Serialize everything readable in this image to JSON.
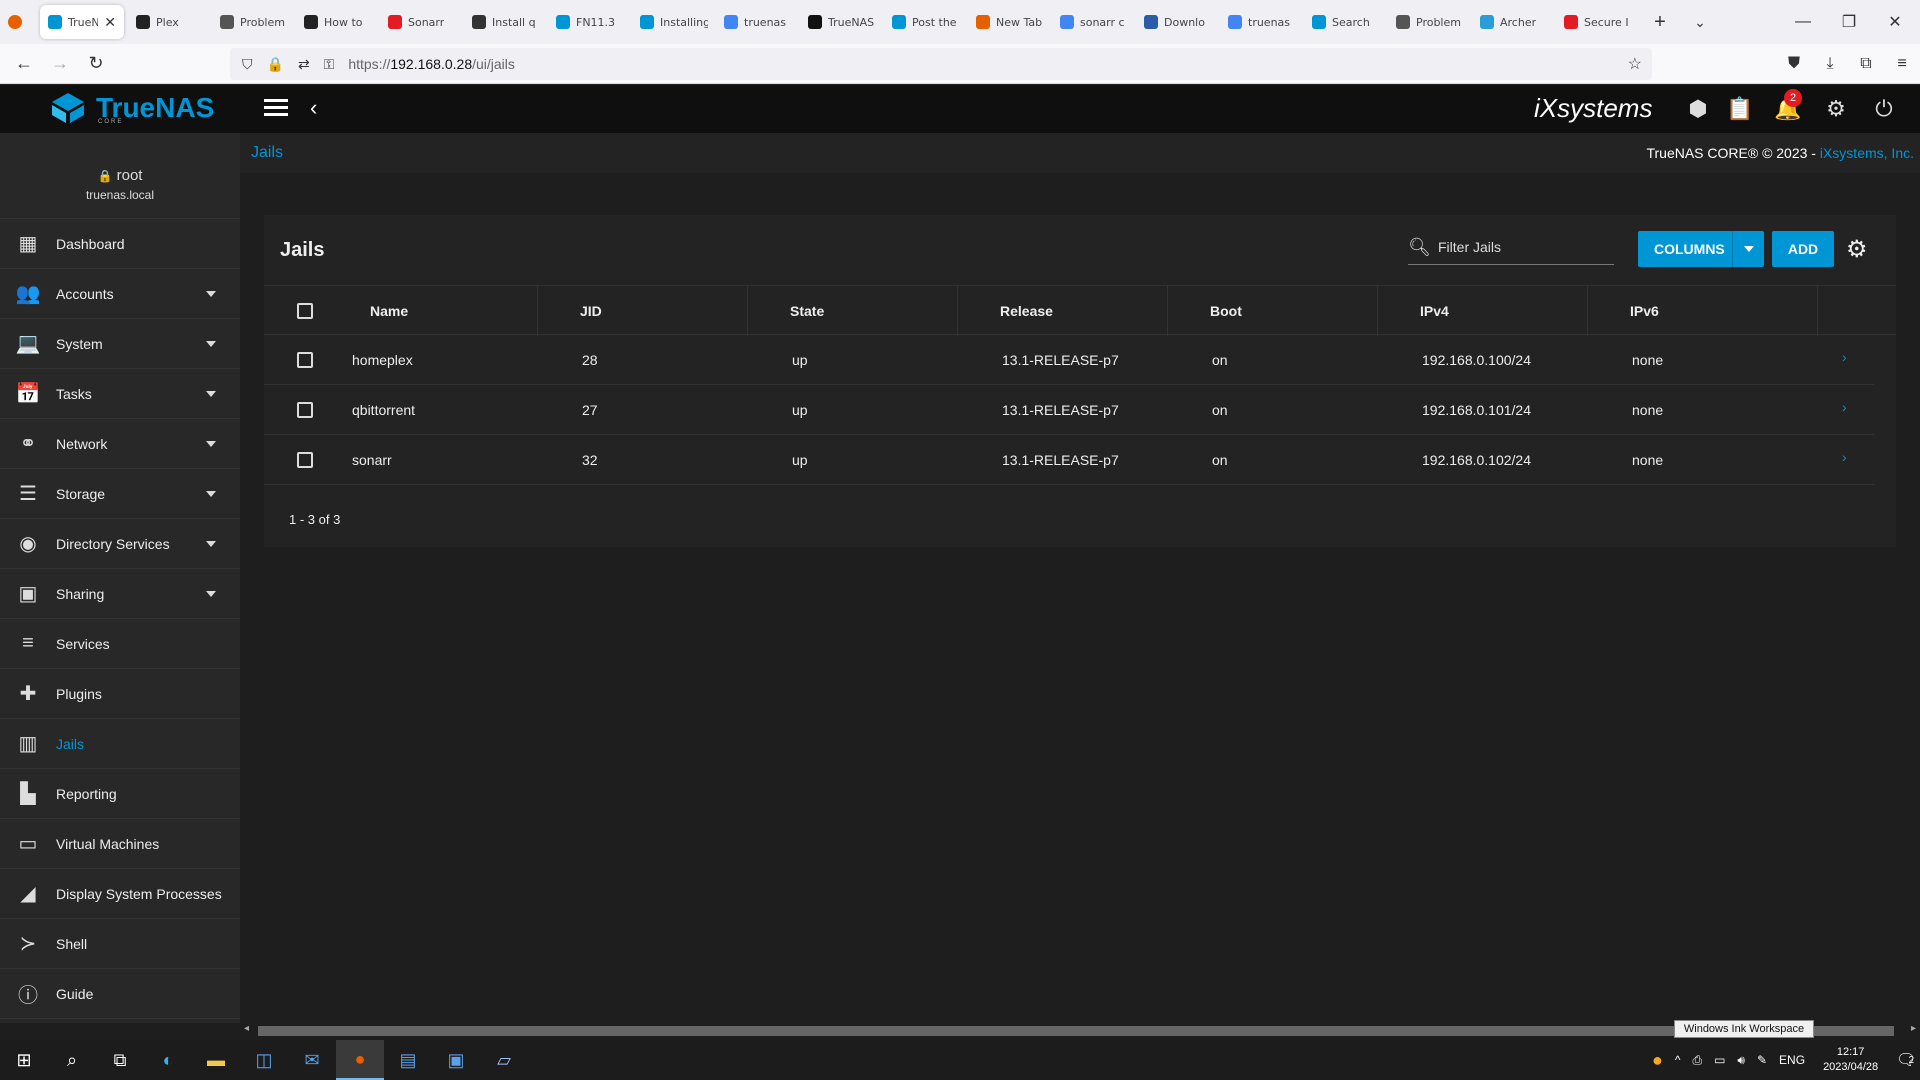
{
  "browser": {
    "tabs": [
      {
        "label": "TrueNAS",
        "color": "#0095d5",
        "active": true
      },
      {
        "label": "Plex",
        "color": "#222"
      },
      {
        "label": "Problem",
        "color": "#555"
      },
      {
        "label": "How to",
        "color": "#222"
      },
      {
        "label": "Sonarr",
        "color": "#e31c23"
      },
      {
        "label": "Install q",
        "color": "#333"
      },
      {
        "label": "FN11.3",
        "color": "#0095d5"
      },
      {
        "label": "Installing",
        "color": "#0095d5"
      },
      {
        "label": "truenas",
        "color": "#4285f4"
      },
      {
        "label": "TrueNAS",
        "color": "#111"
      },
      {
        "label": "Post the",
        "color": "#0095d5"
      },
      {
        "label": "New Tab",
        "color": "#e66000"
      },
      {
        "label": "sonarr c",
        "color": "#4285f4"
      },
      {
        "label": "Downlo",
        "color": "#2a5caa"
      },
      {
        "label": "truenas",
        "color": "#4285f4"
      },
      {
        "label": "Search",
        "color": "#0095d5"
      },
      {
        "label": "Problem",
        "color": "#555"
      },
      {
        "label": "Archer",
        "color": "#2a9dd8"
      },
      {
        "label": "Secure I",
        "color": "#e31c23"
      }
    ],
    "url_prefix": "https://",
    "url_host": "192.168.0.28",
    "url_path": "/ui/jails"
  },
  "app": {
    "logo_text": "TrueNAS",
    "logo_sub": "CORE",
    "vendor_logo": "iXsystems",
    "notifications_count": "2"
  },
  "user": {
    "name": "root",
    "host": "truenas.local"
  },
  "sidebar": {
    "items": [
      {
        "label": "Dashboard",
        "icon": "dashboard-icon",
        "glyph": "▦",
        "expandable": false
      },
      {
        "label": "Accounts",
        "icon": "accounts-icon",
        "glyph": "👥",
        "expandable": true
      },
      {
        "label": "System",
        "icon": "system-icon",
        "glyph": "💻",
        "expandable": true
      },
      {
        "label": "Tasks",
        "icon": "tasks-icon",
        "glyph": "📅",
        "expandable": true
      },
      {
        "label": "Network",
        "icon": "network-icon",
        "glyph": "⚭",
        "expandable": true
      },
      {
        "label": "Storage",
        "icon": "storage-icon",
        "glyph": "☰",
        "expandable": true
      },
      {
        "label": "Directory Services",
        "icon": "directory-services-icon",
        "glyph": "◉",
        "expandable": true
      },
      {
        "label": "Sharing",
        "icon": "sharing-icon",
        "glyph": "▣",
        "expandable": true
      },
      {
        "label": "Services",
        "icon": "services-icon",
        "glyph": "≡",
        "expandable": false
      },
      {
        "label": "Plugins",
        "icon": "plugins-icon",
        "glyph": "✚",
        "expandable": false
      },
      {
        "label": "Jails",
        "icon": "jails-icon",
        "glyph": "▥",
        "expandable": false,
        "active": true
      },
      {
        "label": "Reporting",
        "icon": "reporting-icon",
        "glyph": "▙",
        "expandable": false
      },
      {
        "label": "Virtual Machines",
        "icon": "virtual-machines-icon",
        "glyph": "▭",
        "expandable": false
      },
      {
        "label": "Display System Processes",
        "icon": "processes-icon",
        "glyph": "◢",
        "expandable": false
      },
      {
        "label": "Shell",
        "icon": "shell-icon",
        "glyph": "≻",
        "expandable": false
      },
      {
        "label": "Guide",
        "icon": "guide-icon",
        "glyph": "ⓘ",
        "expandable": false
      }
    ]
  },
  "breadcrumb": "Jails",
  "copyright": {
    "text": "TrueNAS CORE® © 2023 - ",
    "brand": "iXsystems, Inc."
  },
  "jails": {
    "title": "Jails",
    "filter_placeholder": "Filter Jails",
    "columns_label": "COLUMNS",
    "add_label": "ADD",
    "headers": [
      "Name",
      "JID",
      "State",
      "Release",
      "Boot",
      "IPv4",
      "IPv6"
    ],
    "rows": [
      {
        "name": "homeplex",
        "jid": "28",
        "state": "up",
        "release": "13.1-RELEASE-p7",
        "boot": "on",
        "ipv4": "192.168.0.100/24",
        "ipv6": "none"
      },
      {
        "name": "qbittorrent",
        "jid": "27",
        "state": "up",
        "release": "13.1-RELEASE-p7",
        "boot": "on",
        "ipv4": "192.168.0.101/24",
        "ipv6": "none"
      },
      {
        "name": "sonarr",
        "jid": "32",
        "state": "up",
        "release": "13.1-RELEASE-p7",
        "boot": "on",
        "ipv4": "192.168.0.102/24",
        "ipv6": "none"
      }
    ],
    "pagination": "1 - 3 of 3"
  },
  "tooltip": "Windows Ink Workspace",
  "taskbar": {
    "lang": "ENG",
    "time": "12:17",
    "date": "2023/04/28",
    "notif_count": "2"
  }
}
